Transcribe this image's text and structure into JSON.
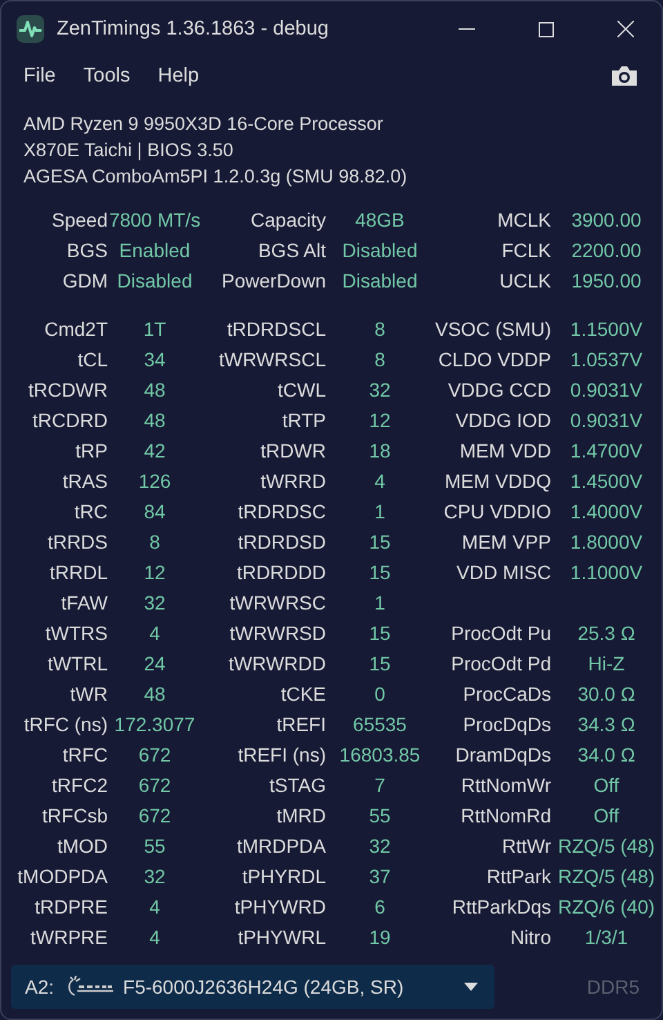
{
  "window": {
    "title": "ZenTimings 1.36.1863 - debug"
  },
  "menu": [
    "File",
    "Tools",
    "Help"
  ],
  "system_info": [
    "AMD Ryzen 9 9950X3D 16-Core Processor",
    "X870E Taichi | BIOS 3.50",
    "AGESA ComboAm5PI 1.2.0.3g (SMU 98.82.0)"
  ],
  "summary": [
    {
      "left": {
        "label": "Speed",
        "value": "7800 MT/s"
      },
      "middle": {
        "label": "Capacity",
        "value": "48GB"
      },
      "right": {
        "label": "MCLK",
        "value": "3900.00"
      }
    },
    {
      "left": {
        "label": "BGS",
        "value": "Enabled"
      },
      "middle": {
        "label": "BGS Alt",
        "value": "Disabled"
      },
      "right": {
        "label": "FCLK",
        "value": "2200.00"
      }
    },
    {
      "left": {
        "label": "GDM",
        "value": "Disabled"
      },
      "middle": {
        "label": "PowerDown",
        "value": "Disabled"
      },
      "right": {
        "label": "UCLK",
        "value": "1950.00"
      }
    }
  ],
  "timings": [
    {
      "left": {
        "label": "Cmd2T",
        "value": "1T"
      },
      "middle": {
        "label": "tRDRDSCL",
        "value": "8"
      },
      "right": {
        "label": "VSOC (SMU)",
        "value": "1.1500V"
      }
    },
    {
      "left": {
        "label": "tCL",
        "value": "34"
      },
      "middle": {
        "label": "tWRWRSCL",
        "value": "8"
      },
      "right": {
        "label": "CLDO VDDP",
        "value": "1.0537V"
      }
    },
    {
      "left": {
        "label": "tRCDWR",
        "value": "48"
      },
      "middle": {
        "label": "tCWL",
        "value": "32"
      },
      "right": {
        "label": "VDDG CCD",
        "value": "0.9031V"
      }
    },
    {
      "left": {
        "label": "tRCDRD",
        "value": "48"
      },
      "middle": {
        "label": "tRTP",
        "value": "12"
      },
      "right": {
        "label": "VDDG IOD",
        "value": "0.9031V"
      }
    },
    {
      "left": {
        "label": "tRP",
        "value": "42"
      },
      "middle": {
        "label": "tRDWR",
        "value": "18"
      },
      "right": {
        "label": "MEM VDD",
        "value": "1.4700V"
      }
    },
    {
      "left": {
        "label": "tRAS",
        "value": "126"
      },
      "middle": {
        "label": "tWRRD",
        "value": "4"
      },
      "right": {
        "label": "MEM VDDQ",
        "value": "1.4500V"
      }
    },
    {
      "left": {
        "label": "tRC",
        "value": "84"
      },
      "middle": {
        "label": "tRDRDSC",
        "value": "1"
      },
      "right": {
        "label": "CPU VDDIO",
        "value": "1.4000V"
      }
    },
    {
      "left": {
        "label": "tRRDS",
        "value": "8"
      },
      "middle": {
        "label": "tRDRDSD",
        "value": "15"
      },
      "right": {
        "label": "MEM VPP",
        "value": "1.8000V"
      }
    },
    {
      "left": {
        "label": "tRRDL",
        "value": "12"
      },
      "middle": {
        "label": "tRDRDDD",
        "value": "15"
      },
      "right": {
        "label": "VDD MISC",
        "value": "1.1000V"
      }
    },
    {
      "left": {
        "label": "tFAW",
        "value": "32"
      },
      "middle": {
        "label": "tWRWRSC",
        "value": "1"
      }
    },
    {
      "left": {
        "label": "tWTRS",
        "value": "4"
      },
      "middle": {
        "label": "tWRWRSD",
        "value": "15"
      },
      "right": {
        "label": "ProcOdt Pu",
        "value": "25.3 Ω"
      }
    },
    {
      "left": {
        "label": "tWTRL",
        "value": "24"
      },
      "middle": {
        "label": "tWRWRDD",
        "value": "15"
      },
      "right": {
        "label": "ProcOdt Pd",
        "value": "Hi-Z"
      }
    },
    {
      "left": {
        "label": "tWR",
        "value": "48"
      },
      "middle": {
        "label": "tCKE",
        "value": "0"
      },
      "right": {
        "label": "ProcCaDs",
        "value": "30.0 Ω"
      }
    },
    {
      "left": {
        "label": "tRFC (ns)",
        "value": "172.3077"
      },
      "middle": {
        "label": "tREFI",
        "value": "65535"
      },
      "right": {
        "label": "ProcDqDs",
        "value": "34.3 Ω"
      }
    },
    {
      "left": {
        "label": "tRFC",
        "value": "672"
      },
      "middle": {
        "label": "tREFI (ns)",
        "value": "16803.85"
      },
      "right": {
        "label": "DramDqDs",
        "value": "34.0 Ω"
      }
    },
    {
      "left": {
        "label": "tRFC2",
        "value": "672"
      },
      "middle": {
        "label": "tSTAG",
        "value": "7"
      },
      "right": {
        "label": "RttNomWr",
        "value": "Off"
      }
    },
    {
      "left": {
        "label": "tRFCsb",
        "value": "672"
      },
      "middle": {
        "label": "tMRD",
        "value": "55"
      },
      "right": {
        "label": "RttNomRd",
        "value": "Off"
      }
    },
    {
      "left": {
        "label": "tMOD",
        "value": "55"
      },
      "middle": {
        "label": "tMRDPDA",
        "value": "32"
      },
      "right": {
        "label": "RttWr",
        "value": "RZQ/5 (48)"
      }
    },
    {
      "left": {
        "label": "tMODPDA",
        "value": "32"
      },
      "middle": {
        "label": "tPHYRDL",
        "value": "37"
      },
      "right": {
        "label": "RttPark",
        "value": "RZQ/5 (48)"
      }
    },
    {
      "left": {
        "label": "tRDPRE",
        "value": "4"
      },
      "middle": {
        "label": "tPHYWRD",
        "value": "6"
      },
      "right": {
        "label": "RttParkDqs",
        "value": "RZQ/6 (40)"
      }
    },
    {
      "left": {
        "label": "tWRPRE",
        "value": "4"
      },
      "middle": {
        "label": "tPHYWRL",
        "value": "19"
      },
      "right": {
        "label": "Nitro",
        "value": "1/3/1"
      }
    }
  ],
  "footer": {
    "slot": "A2:",
    "module": "F5-6000J2636H24G (24GB, SR)",
    "memory_type": "DDR5"
  }
}
